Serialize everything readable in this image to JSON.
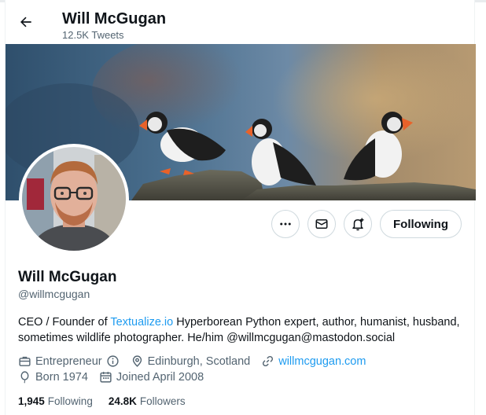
{
  "header": {
    "name": "Will McGugan",
    "tweet_count": "12.5K Tweets"
  },
  "profile": {
    "name": "Will McGugan",
    "handle": "@willmcgugan",
    "bio_prefix": "CEO / Founder of ",
    "bio_link": "Textualize.io",
    "bio_suffix": " Hyperborean Python expert, author, humanist, husband, sometimes wildlife photographer. He/him @willmcgugan@mastodon.social",
    "category": "Entrepreneur",
    "location": "Edinburgh, Scotland",
    "website": "willmcgugan.com",
    "born": "Born 1974",
    "joined": "Joined April 2008"
  },
  "actions": {
    "follow_label": "Following"
  },
  "stats": {
    "following_count": "1,945",
    "following_label": "Following",
    "followers_count": "24.8K",
    "followers_label": "Followers"
  },
  "colors": {
    "accent": "#1d9bf0",
    "secondary_text": "#536471",
    "border": "#cfd9de"
  },
  "icons": [
    "back-arrow-icon",
    "more-icon",
    "mail-icon",
    "notification-bell-icon",
    "briefcase-icon",
    "info-icon",
    "location-pin-icon",
    "link-icon",
    "balloon-icon",
    "calendar-icon"
  ]
}
